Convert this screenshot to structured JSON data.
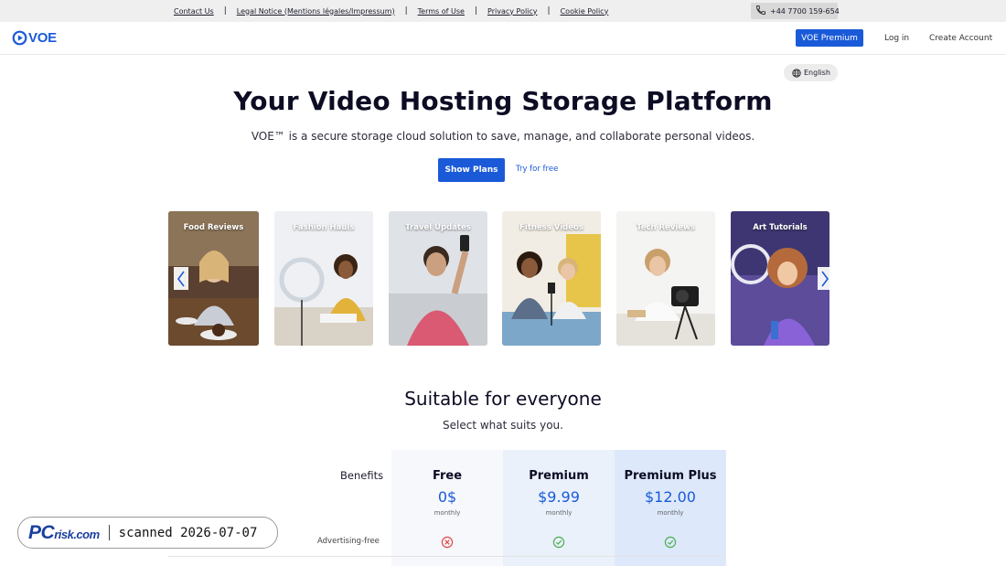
{
  "topbar": {
    "links": [
      "Contact Us",
      "Legal Notice (Mentions légales/Impressum)",
      "Terms of Use",
      "Privacy Policy",
      "Cookie Policy"
    ],
    "separator": "|",
    "phone": "+44 7700 159-654"
  },
  "header": {
    "logo_text": "VOE",
    "premium_button": "VOE Premium",
    "login": "Log in",
    "create_account": "Create Account"
  },
  "language": {
    "label": "English"
  },
  "hero": {
    "title": "Your Video Hosting Storage Platform",
    "subtitle": "VOE™ is a secure storage cloud solution to save, manage, and collaborate personal videos.",
    "show_plans": "Show Plans",
    "try_free": "Try for free"
  },
  "carousel": {
    "cards": [
      "Food Reviews",
      "Fashion Hauls",
      "Travel Updates",
      "Fitness Videos",
      "Tech Reviews",
      "Art Tutorials"
    ]
  },
  "pricing": {
    "title": "Suitable for everyone",
    "subtitle": "Select what suits you.",
    "benefits_header": "Benefits",
    "plans": [
      {
        "name": "Free",
        "price": "0$",
        "period": "monthly"
      },
      {
        "name": "Premium",
        "price": "$9.99",
        "period": "monthly"
      },
      {
        "name": "Premium Plus",
        "price": "$12.00",
        "period": "monthly"
      }
    ],
    "rows": [
      {
        "label": "Advertising-free",
        "values": [
          "no",
          "yes",
          "yes"
        ]
      }
    ]
  },
  "watermark": {
    "logo": {
      "pc": "PC",
      "risk": "risk.com"
    },
    "text": "scanned 2026-07-07"
  },
  "colors": {
    "accent": "#1a5ad8",
    "yes": "#4caf50",
    "no": "#e04848"
  }
}
